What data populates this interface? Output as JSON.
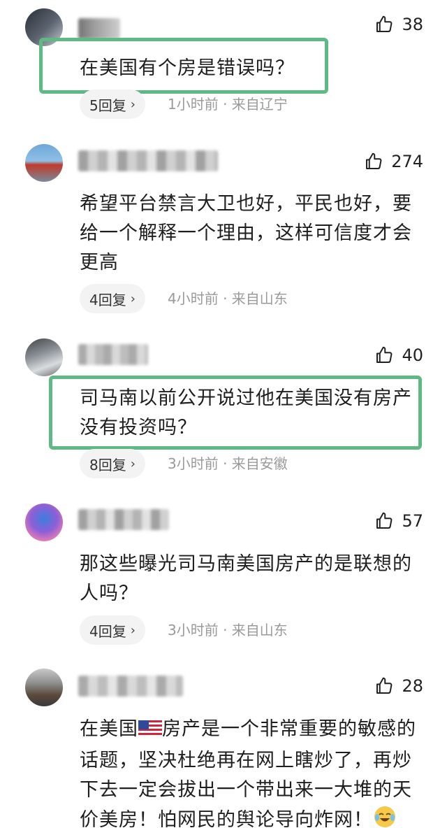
{
  "comments": [
    {
      "likes": "38",
      "lines": [
        "在美国有个房是错误吗？"
      ],
      "replies": "5回复",
      "meta": "1小时前 · 来自辽宁"
    },
    {
      "likes": "274",
      "lines": [
        "希望平台禁言大卫也好，平民也好，要",
        "给一个解释一个理由，这样可信度才会",
        "更高"
      ],
      "replies": "4回复",
      "meta": "4小时前 · 来自山东"
    },
    {
      "likes": "40",
      "lines": [
        "司马南以前公开说过他在美国没有房产",
        "没有投资吗？"
      ],
      "replies": "8回复",
      "meta": "3小时前 · 来自安徽"
    },
    {
      "likes": "57",
      "lines": [
        "那这些曝光司马南美国房产的是联想的",
        "人吗？"
      ],
      "replies": "4回复",
      "meta": "3小时前 · 来自山东"
    },
    {
      "likes": "28",
      "line1_a": "在美国",
      "line1_b": "房产是一个非常重要的敏感的",
      "line2": "话题，坚决杜绝再在网上瞎炒了，再炒",
      "line3": "下去一定会拔出一个带出来一大堆的天",
      "line4": "价美房！怕网民的舆论导向炸网！"
    }
  ],
  "colors": {
    "highlight": "#5fb985",
    "meta_text": "#9a9a9a",
    "reply_bg": "#f3f3f3"
  },
  "icons": {
    "like": "thumbs-up-outline-icon",
    "chevron": "chevron-right-icon",
    "flag": "us-flag-emoji",
    "laugh": "tears-of-joy-emoji"
  }
}
